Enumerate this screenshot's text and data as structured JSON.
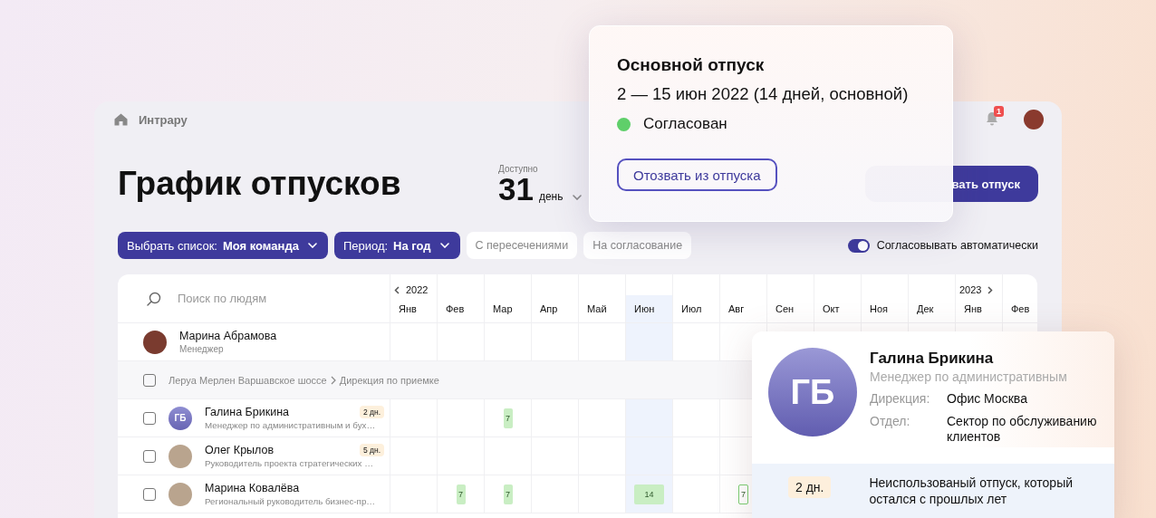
{
  "topbar": {
    "breadcrumb": "Интрару",
    "notifications": "1"
  },
  "header": {
    "title": "График отпусков",
    "available": {
      "label": "Доступно",
      "value": "31",
      "unit": "день"
    },
    "primary_button": "вать отпуск"
  },
  "filters": [
    {
      "kind": "select",
      "label": "Выбрать список:",
      "value": "Моя команда"
    },
    {
      "kind": "select",
      "label": "Период:",
      "value": "На год"
    },
    {
      "kind": "chip",
      "label": "С пересечениями",
      "selected": false
    },
    {
      "kind": "chip",
      "label": "На согласование",
      "selected": false
    }
  ],
  "auto_approve": {
    "label": "Согласовывать автоматически",
    "on": true
  },
  "table": {
    "search_placeholder": "Поиск по людям",
    "months": [
      {
        "label": "Янв",
        "selected": false,
        "year": "2022"
      },
      {
        "label": "Фев",
        "selected": false
      },
      {
        "label": "Мар",
        "selected": false
      },
      {
        "label": "Апр",
        "selected": false
      },
      {
        "label": "Май",
        "selected": false
      },
      {
        "label": "Июн",
        "selected": true
      },
      {
        "label": "Июл",
        "selected": false
      },
      {
        "label": "Авг",
        "selected": false
      },
      {
        "label": "Сен",
        "selected": false
      },
      {
        "label": "Окт",
        "selected": false
      },
      {
        "label": "Ноя",
        "selected": false
      },
      {
        "label": "Дек",
        "selected": false
      },
      {
        "label": "Янв",
        "selected": false,
        "year": "2023"
      },
      {
        "label": "Фев",
        "selected": false
      }
    ],
    "manager": {
      "name": "Марина Абрамова",
      "role": "Менеджер"
    },
    "group": {
      "path": [
        "Леруа Мерлен Варшавское шоссе",
        "Дирекция по приемке"
      ],
      "checked": false
    },
    "employees": [
      {
        "name": "Галина Брикина",
        "role": "Менеджер по административным и бух…",
        "initials": "ГБ",
        "badge": "2 дн.",
        "checked": false,
        "vacations": [
          {
            "days": "7",
            "outlined": false
          }
        ]
      },
      {
        "name": "Олег Крылов",
        "role": "Руководитель проекта стратегических …",
        "badge": "5 дн.",
        "checked": false
      },
      {
        "name": "Марина Ковалёва",
        "role": "Региональный руководитель бизнес-пр…",
        "checked": false,
        "vacations": [
          {
            "days": "7",
            "outlined": false
          },
          {
            "days": "7",
            "outlined": false
          },
          {
            "days": "14",
            "outlined": false
          },
          {
            "days": "7",
            "outlined": true
          }
        ]
      }
    ]
  },
  "popover": {
    "title": "Основной отпуск",
    "dates": "2 — 15 июн 2022 (14 дней, основной)",
    "status": {
      "label": "Согласован",
      "color": "#5fcf6a"
    },
    "button": "Отозвать из отпуска"
  },
  "profile_card": {
    "initials": "ГБ",
    "name": "Галина Брикина",
    "role": "Менеджер по административным",
    "fields": [
      {
        "label": "Дирекция:",
        "value": "Офис Москва"
      },
      {
        "label": "Отдел:",
        "value": "Сектор по обслуживанию клиентов"
      }
    ],
    "badge": "2 дн.",
    "note": "Неиспользованый отпуск, который остался с прошлых лет"
  }
}
